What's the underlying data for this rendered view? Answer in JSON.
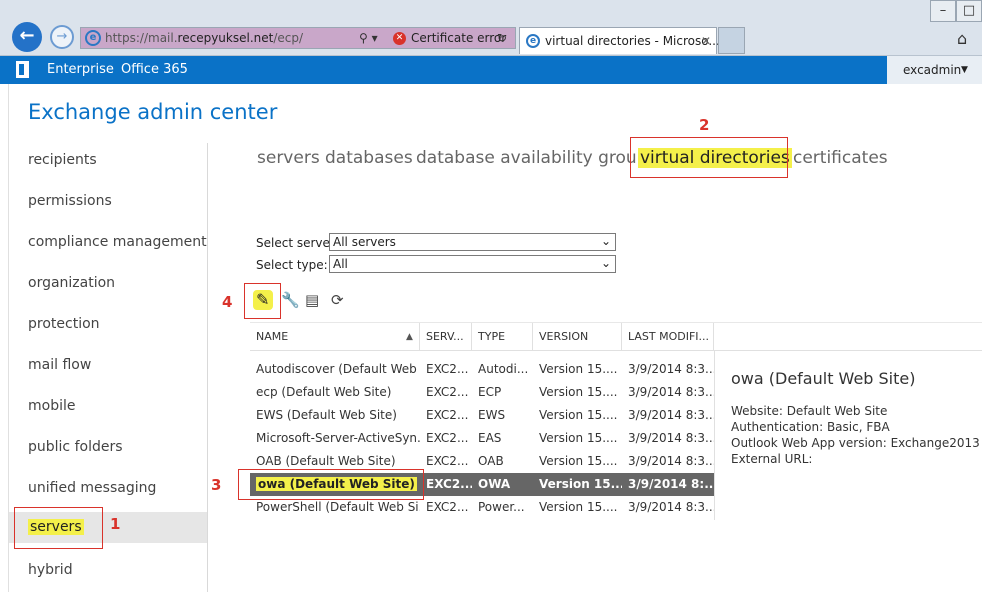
{
  "browser": {
    "url_prefix": "https://mail.",
    "url_domain": "recepyuksel.net",
    "url_path": "/ecp/",
    "tools_glyph": "⚲ ▾",
    "cert_error": "Certificate error",
    "reload_glyph": "↻",
    "tab_title": "virtual directories - Microso...",
    "tab_close": "✕"
  },
  "topbar": {
    "enterprise": "Enterprise",
    "office365": "Office 365",
    "user": "excadmin",
    "user_caret": "▼"
  },
  "app_title": "Exchange admin center",
  "nav": {
    "items": [
      "recipients",
      "permissions",
      "compliance management",
      "organization",
      "protection",
      "mail flow",
      "mobile",
      "public folders",
      "unified messaging",
      "servers",
      "hybrid"
    ],
    "selected": "servers"
  },
  "tabs": [
    "servers",
    "databases",
    "database availability groups",
    "virtual directories",
    "certificates"
  ],
  "active_tab": "virtual directories",
  "filters": {
    "server_label": "Select server:",
    "server_value": "All servers",
    "type_label": "Select type:",
    "type_value": "All"
  },
  "table": {
    "columns": [
      "NAME",
      "SERV...",
      "TYPE",
      "VERSION",
      "LAST MODIFI..."
    ],
    "rows": [
      [
        "Autodiscover (Default Web ...",
        "EXC2...",
        "Autodi...",
        "Version 15....",
        "3/9/2014 8:3..."
      ],
      [
        "ecp (Default Web Site)",
        "EXC2...",
        "ECP",
        "Version 15....",
        "3/9/2014 8:3..."
      ],
      [
        "EWS (Default Web Site)",
        "EXC2...",
        "EWS",
        "Version 15....",
        "3/9/2014 8:3..."
      ],
      [
        "Microsoft-Server-ActiveSyn...",
        "EXC2...",
        "EAS",
        "Version 15....",
        "3/9/2014 8:3..."
      ],
      [
        "OAB (Default Web Site)",
        "EXC2...",
        "OAB",
        "Version 15....",
        "3/9/2014 8:3..."
      ],
      [
        "owa (Default Web Site)",
        "EXC2...",
        "OWA",
        "Version 15....",
        "3/9/2014 8:..."
      ],
      [
        "PowerShell (Default Web Si...",
        "EXC2...",
        "Power...",
        "Version 15....",
        "3/9/2014 8:3..."
      ]
    ],
    "selected_index": 5
  },
  "details": {
    "title": "owa (Default Web Site)",
    "website": "Website: Default Web Site",
    "auth": "Authentication: Basic, FBA",
    "version": "Outlook Web App version: Exchange2013",
    "external": "External URL:"
  },
  "annotations": [
    "1",
    "2",
    "3",
    "4"
  ],
  "colors": {
    "brand_blue": "#0a72c7",
    "highlight": "#f4f04a",
    "annotation": "#d9332b"
  }
}
